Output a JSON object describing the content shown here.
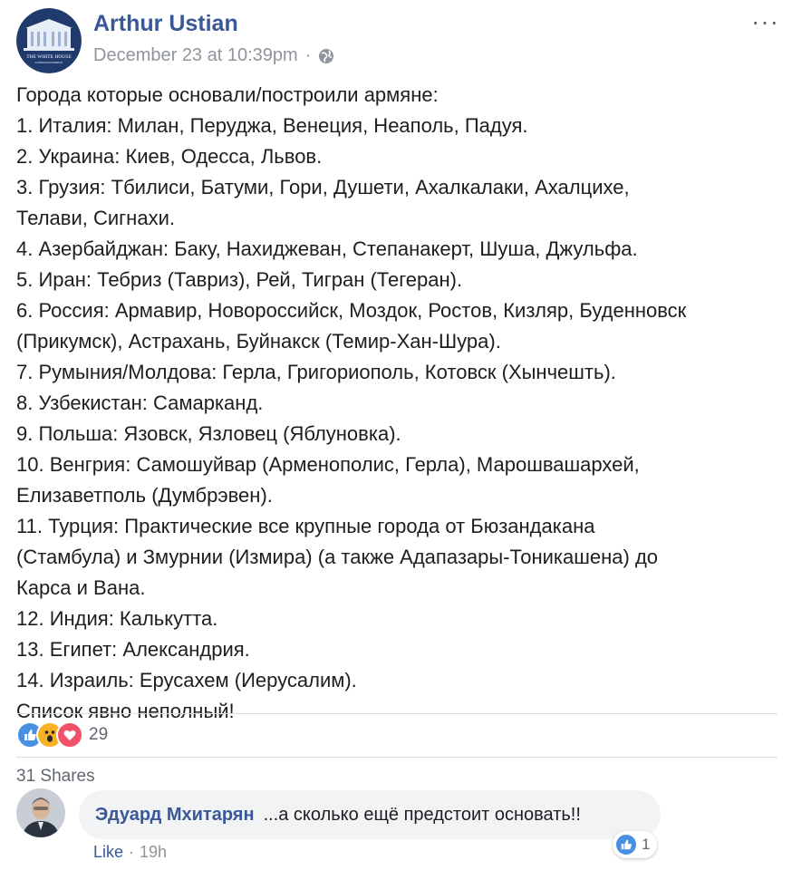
{
  "post": {
    "author": "Arthur Ustian",
    "timestamp": "December 23 at 10:39pm",
    "separator": "·",
    "more_label": "···",
    "avatar_caption": "THE WHITE HOUSE",
    "avatar_subcaption": "CONSTANTINOPLE",
    "lines": [
      "Города которые основали/построили армяне:",
      "1. Италия: Милан, Перуджа, Венеция, Неаполь, Падуя.",
      "2. Украина: Киев, Одесса, Львов.",
      "3. Грузия: Тбилиси, Батуми, Гори, Душети, Ахалкалаки, Ахалцихе,",
      "Телави, Сигнахи.",
      "4. Азербайджан: Баку, Нахиджеван, Степанакерт, Шуша, Джульфа.",
      "5. Иран: Тебриз (Тавриз), Рей, Тигран (Тегеран).",
      "6. Россия: Армавир, Новороссийск, Моздок, Ростов, Кизляр, Буденновск",
      "(Прикумск), Астрахань, Буйнакск (Темир-Хан-Шура).",
      "7. Румыния/Молдова: Герла, Григориополь, Котовск (Хынчешть).",
      "8. Узбекистан: Самарканд.",
      "9. Польша: Язовск, Язловец (Яблуновка).",
      "10. Венгрия: Самошуйвар (Арменополис, Герла), Марошвашархей,",
      "Елизаветполь (Думбрэвен).",
      "11. Турция: Практические все крупные города от Бюзандакана",
      "(Стамбула) и Змурнии (Измира) (а также Адапазары-Тоникашена) до",
      "Карса и Вана.",
      "12. Индия: Калькутта.",
      "13. Египет: Александрия.",
      "14. Израиль: Ерусахем (Иерусалим).",
      "Список явно неполный!"
    ]
  },
  "reactions": {
    "icons": [
      "like-icon",
      "wow-icon",
      "love-icon"
    ],
    "count": "29",
    "colors": {
      "like": "#4a90e2",
      "wow": "#f7b125",
      "love": "#f25268"
    }
  },
  "shares": "31 Shares",
  "comment": {
    "author": "Эдуард Мхитарян",
    "text": "...а сколько ещё предстоит основать!!",
    "like_count": "1",
    "like_label": "Like",
    "time": "19h",
    "separator": "·"
  },
  "colors": {
    "link": "#385898",
    "muted": "#90949c",
    "text": "#1c1e21"
  }
}
